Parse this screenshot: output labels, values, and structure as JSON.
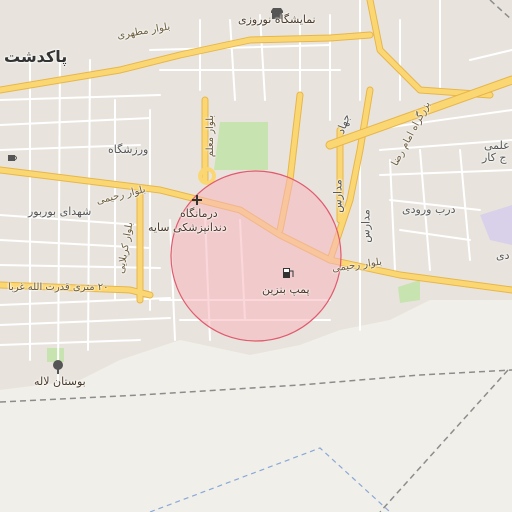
{
  "map": {
    "colors": {
      "background": "#f1efe9",
      "urban": "#e8e4dd",
      "minor_road": "#ffffff",
      "major_road": "#fbd774",
      "major_road_casing": "#e7b64a",
      "park": "#c7e3b0",
      "circle_fill": "#f7b6bd",
      "circle_stroke": "#e05b6e",
      "boundary": "#8c8c8c",
      "boundary_blue": "#8aa8d8"
    },
    "highlight": {
      "kind": "radius-circle"
    },
    "labels": {
      "city": "پاکدشت",
      "mall": "نمایشگاه نوروزی",
      "blvd_motahari": "بلوار مطهری",
      "sport": "ورزشگاه",
      "blvd_moallem": "بلوار معلم",
      "blvd_rahimi_w": "بلوار رحیمی",
      "shohada": "شهدای بوربور",
      "clinic_1": "درمانگاه",
      "clinic_2": "دندانپزشکی سایه",
      "blvd_karbalaei": "بلوار کربلایی",
      "blvd_rahimi_e": "بلوار رحیمی",
      "fuel": "پمپ بنزین",
      "street_20m": "۲۰ متری قدرت الله غربا",
      "park_lale": "بوستان لاله",
      "imam_reza": "بزرگراه امام رضا",
      "entrance": "درب ورودی",
      "madares": "مدارس",
      "madares_2": "مدارس",
      "jahad": "جهاد",
      "elmi": "علمی",
      "kar": "ج کار",
      "davi": "دی"
    },
    "icons": [
      "shop-icon",
      "cafe-icon",
      "hospital-icon",
      "fuel-icon",
      "park-tree-icon"
    ]
  }
}
